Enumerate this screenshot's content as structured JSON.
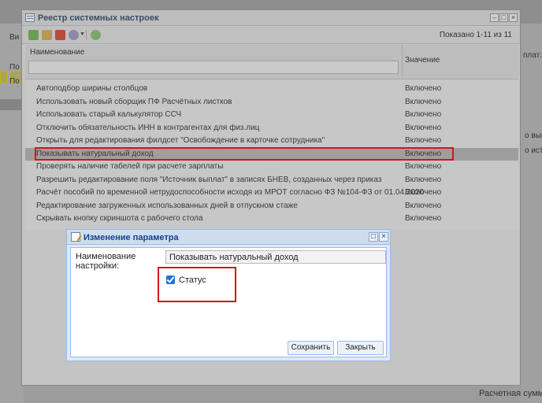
{
  "background": {
    "left_labels": [
      "Ви",
      "По",
      "По"
    ],
    "right_labels": [
      "плат:",
      "о выпл",
      "о исто"
    ],
    "bottom_label": "Расчетная сумма:"
  },
  "window": {
    "title": "Реестр системных настроек",
    "count_text": "Показано 1-11 из 11",
    "columns": {
      "name": "Наименование",
      "value": "Значение"
    },
    "rows": [
      {
        "name": "Автоподбор ширины столбцов",
        "value": "Включено"
      },
      {
        "name": "Использовать новый сборщик ПФ Расчётных листков",
        "value": "Включено"
      },
      {
        "name": "Использовать старый калькулятор ССЧ",
        "value": "Включено"
      },
      {
        "name": "Отключить обязательность ИНН в контрагентах для физ.лиц",
        "value": "Включено"
      },
      {
        "name": "Открыть для редактирования филдсет \"Освобождение в карточке сотрудника\"",
        "value": "Включено"
      },
      {
        "name": "Показывать натуральный доход",
        "value": "Включено"
      },
      {
        "name": "Проверять наличие табелей при расчете зарплаты",
        "value": "Включено"
      },
      {
        "name": "Разрешить редактирование поля \"Источник выплат\" в записях БНЕВ, созданных через приказ",
        "value": "Включено"
      },
      {
        "name": "Расчёт пособий по временной нетрудоспособности исходя из МРОТ согласно ФЗ №104-ФЗ от 01.04.2020",
        "value": "Включено"
      },
      {
        "name": "Редактирование загруженных использованных дней в отпускном стаже",
        "value": "Включено"
      },
      {
        "name": "Скрывать кнопку скриншота с рабочего стола",
        "value": "Включено"
      }
    ]
  },
  "dialog": {
    "title": "Изменение параметра",
    "label": "Наименование настройки:",
    "field_value": "Показывать натуральный доход",
    "checkbox_label": "Статус",
    "checkbox_checked": true,
    "save_label": "Сохранить",
    "close_label": "Закрыть"
  }
}
